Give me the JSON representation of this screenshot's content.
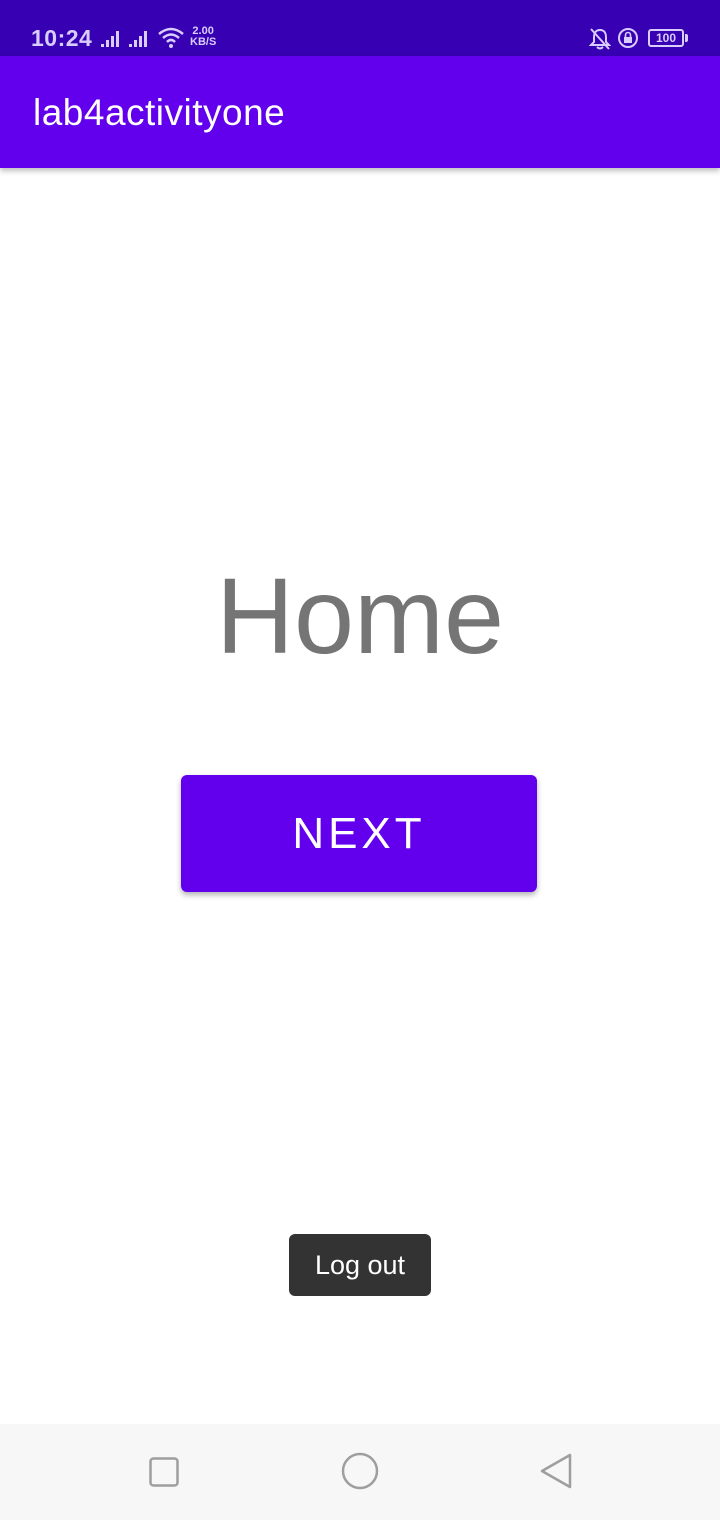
{
  "status_bar": {
    "time": "10:24",
    "net_speed_value": "2.00",
    "net_speed_unit": "KB/S",
    "battery_level": "100",
    "icons": [
      "signal-icon",
      "signal-icon",
      "wifi-icon",
      "bell-off-icon",
      "rotation-lock-icon",
      "battery-icon"
    ]
  },
  "app_bar": {
    "title": "lab4activityone"
  },
  "main": {
    "heading": "Home",
    "next_label": "NEXT"
  },
  "toast": {
    "message": "Log out"
  },
  "nav_bar": {
    "icons": [
      "recents-icon",
      "home-icon",
      "back-icon"
    ]
  },
  "colors": {
    "status_bar": "#3700b3",
    "primary": "#6200ee",
    "heading_text": "#757575",
    "toast_bg": "#333333"
  }
}
